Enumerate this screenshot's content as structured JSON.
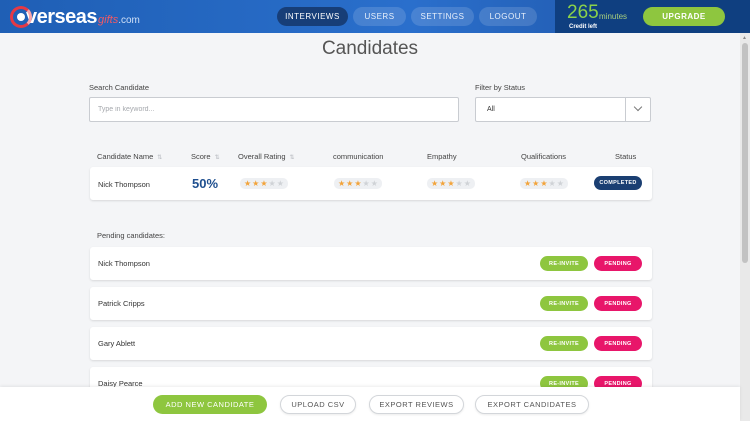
{
  "brand": {
    "name_main": "verseas",
    "name_sub": "gifts",
    "domain": ".com",
    "logo_icon": "overseas-ring-logo"
  },
  "nav": [
    {
      "label": "INTERVIEWS",
      "active": true
    },
    {
      "label": "USERS",
      "active": false
    },
    {
      "label": "SETTINGS",
      "active": false
    },
    {
      "label": "LOGOUT",
      "active": false
    }
  ],
  "credit": {
    "amount": "265",
    "unit": "minutes",
    "caption": "Credit left"
  },
  "upgrade_label": "UPGRADE",
  "page_title": "Candidates",
  "search": {
    "label": "Search Candidate",
    "placeholder": "Type in keyword..."
  },
  "filter": {
    "label": "Filter by Status",
    "value": "All"
  },
  "table_headers": {
    "name": "Candidate Name",
    "score": "Score",
    "overall": "Overall Rating",
    "communication": "communication",
    "empathy": "Empathy",
    "qualifications": "Qualifications",
    "status": "Status"
  },
  "completed_candidate": {
    "name": "Nick Thompson",
    "score": "50%",
    "ratings": {
      "overall": 3,
      "communication": 3,
      "empathy": 3,
      "qualifications": 3
    },
    "rating_max": 5,
    "status": "COMPLETED"
  },
  "pending_title": "Pending candidates:",
  "pending_candidates": [
    {
      "name": "Nick Thompson",
      "reinvite": "RE-INVITE",
      "status": "PENDING"
    },
    {
      "name": "Patrick Cripps",
      "reinvite": "RE-INVITE",
      "status": "PENDING"
    },
    {
      "name": "Gary Ablett",
      "reinvite": "RE-INVITE",
      "status": "PENDING"
    },
    {
      "name": "Daisy Pearce",
      "reinvite": "RE-INVITE",
      "status": "PENDING"
    }
  ],
  "footer": {
    "add": "ADD NEW CANDIDATE",
    "upload": "UPLOAD CSV",
    "export_reviews": "EXPORT REVIEWS",
    "export_candidates": "EXPORT CANDIDATES"
  },
  "colors": {
    "header": "#2a6fcc",
    "accent_green": "#8ec63f",
    "pending_pink": "#e8166a",
    "completed_navy": "#1b3f72"
  }
}
